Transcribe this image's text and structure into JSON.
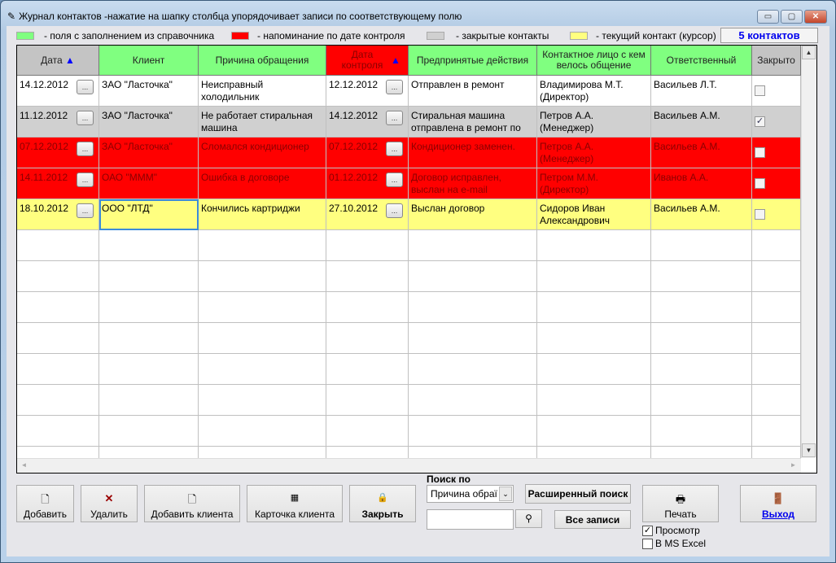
{
  "window": {
    "title": "Журнал контактов -нажатие на шапку столбца упорядочивает записи по соответствующему полю",
    "minimize": "▭",
    "maximize": "▢",
    "close": "✕"
  },
  "legend": [
    {
      "label": "- поля с заполнением из справочника",
      "color": "#80ff80"
    },
    {
      "label": "- напоминание по дате контроля",
      "color": "#ff0000"
    },
    {
      "label": "- закрытые контакты",
      "color": "#d0d0d0"
    },
    {
      "label": "- текущий контакт (курсор)",
      "color": "#ffff80"
    }
  ],
  "count_label": "5 контактов",
  "columns": [
    "Дата",
    "Клиент",
    "Причина обращения",
    "Дата контроля",
    "Предпринятые действия",
    "Контактное лицо с кем велось общение",
    "Ответственный",
    "Закрыто"
  ],
  "columns_display": {
    "date": "Дата",
    "client": "Клиент",
    "reason": "Причина обращения",
    "control_date": "Дата контроля",
    "actions": "Предпринятые действия",
    "contact": "Контактное лицо с кем велось общение",
    "contact_display": "Контактное лицо с кем велось общение",
    "responsible": "Ответственный",
    "closed": "Закрыто"
  },
  "rows": [
    {
      "date": "14.12.2012",
      "client": "ЗАО \"Ласточка\"",
      "reason": "Неисправный холодильник",
      "control": "12.12.2012",
      "action": "Отправлен в ремонт",
      "contact": "Владимирова М.Т. (Директор)",
      "resp": "Васильев Л.Т.",
      "closed": "",
      "style": "white"
    },
    {
      "date": "11.12.2012",
      "client": "ЗАО \"Ласточка\"",
      "reason": "Не работает стиральная машина",
      "control": "14.12.2012",
      "action": "Стиральная машина отправлена в ремонт по",
      "contact": "Петров А.А. (Менеджер)",
      "resp": "Васильев А.М.",
      "closed": "✓",
      "style": "closed"
    },
    {
      "date": "07.12.2012",
      "client": "ЗАО \"Ласточка\"",
      "reason": "Сломался кондиционер",
      "control": "07.12.2012",
      "action": "Кондиционер заменен.",
      "contact": "Петров А.А. (Менеджер)",
      "resp": "Васильев А.М.",
      "closed": "",
      "style": "reminder"
    },
    {
      "date": "14.11.2012",
      "client": "ОАО \"МММ\"",
      "reason": "Ошибка в договоре",
      "control": "01.12.2012",
      "action": "Договор исправлен, выслан на e-mail",
      "contact": "Петром М.М. (Директор)",
      "resp": "Иванов А.А.",
      "closed": "",
      "style": "reminder"
    },
    {
      "date": "18.10.2012",
      "client": "ООО \"ЛТД\"",
      "reason": "Кончились картриджи",
      "control": "27.10.2012",
      "action": "Выслан договор",
      "contact": "Сидоров Иван Александрович",
      "resp": "Васильев А.М.",
      "closed": "",
      "style": "current"
    }
  ],
  "dots": "...",
  "sort_icon": "▲",
  "buttons": {
    "add": "Добавить",
    "delete": "Удалить",
    "add_client": "Добавить клиента",
    "client_card": "Карточка клиента",
    "close": "Закрыть",
    "advanced_search": "Расширенный поиск",
    "all_records": "Все записи",
    "print": "Печать",
    "exit": "Выход"
  },
  "search": {
    "label": "Поиск по",
    "field": "Причина обраї",
    "value": ""
  },
  "options": {
    "preview": "Просмотр",
    "preview_checked": true,
    "excel": "В MS Excel",
    "excel_checked": false
  }
}
